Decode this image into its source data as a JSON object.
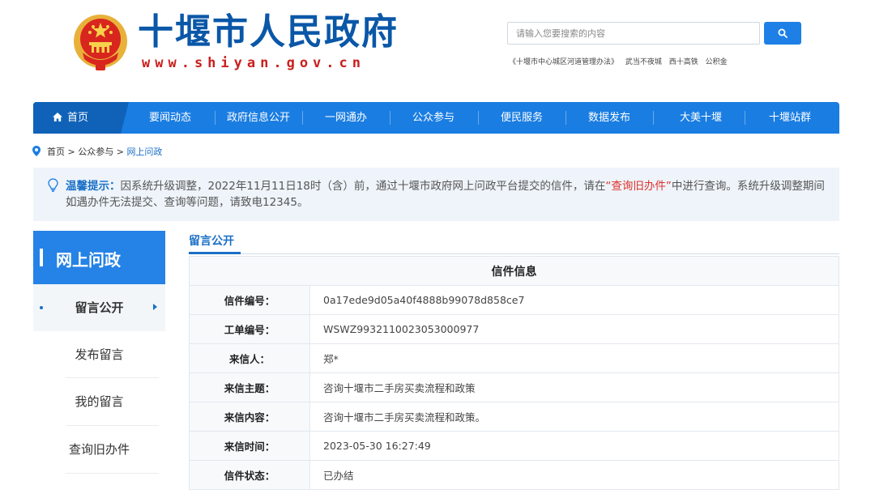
{
  "header": {
    "site_title": "十堰市人民政府",
    "site_url": "www.shiyan.gov.cn",
    "search_placeholder": "请输入您要搜索的内容",
    "hot_links": [
      "《十堰市中心城区河道管理办法》",
      "武当不夜城",
      "西十高铁",
      "公积金"
    ],
    "colors": {
      "title": "#0a57a8",
      "url": "#c8201d",
      "search_button": "#1e80e6"
    }
  },
  "nav": {
    "home": "首页",
    "items": [
      "要闻动态",
      "政府信息公开",
      "一网通办",
      "公众参与",
      "便民服务",
      "数据发布",
      "大美十堰",
      "十堰站群"
    ],
    "colors": {
      "bar": "#1a7de2",
      "home": "#0f62b8"
    }
  },
  "breadcrumb": {
    "home": "首页",
    "sep": " > ",
    "parent": "公众参与",
    "current": "网上问政"
  },
  "notice": {
    "title": "温馨提示：",
    "text_before": "因系统升级调整，2022年11月11日18时（含）前，通过十堰市政府网上问政平台提交的信件，请在",
    "link": "“查询旧办件”",
    "text_after": "中进行查询。系统升级调整期间如遇办件无法提交、查询等问题，请致电12345。"
  },
  "sidebar": {
    "title": "网上问政",
    "items": [
      "留言公开",
      "发布留言",
      "我的留言",
      "查询旧办件"
    ],
    "active_index": 0
  },
  "main": {
    "tab": "留言公开",
    "table_caption": "信件信息",
    "rows": [
      {
        "label": "信件编号：",
        "value": "0a17ede9d05a40f4888b99078d858ce7"
      },
      {
        "label": "工单编号：",
        "value": "WSWZ9932110023053000977"
      },
      {
        "label": "来信人：",
        "value": "郑*"
      },
      {
        "label": "来信主题：",
        "value": "咨询十堰市二手房买卖流程和政策"
      },
      {
        "label": "来信内容：",
        "value": "咨询十堰市二手房买卖流程和政策。"
      },
      {
        "label": "来信时间：",
        "value": "2023-05-30 16:27:49"
      },
      {
        "label": "信件状态：",
        "value": "已办结"
      }
    ]
  }
}
